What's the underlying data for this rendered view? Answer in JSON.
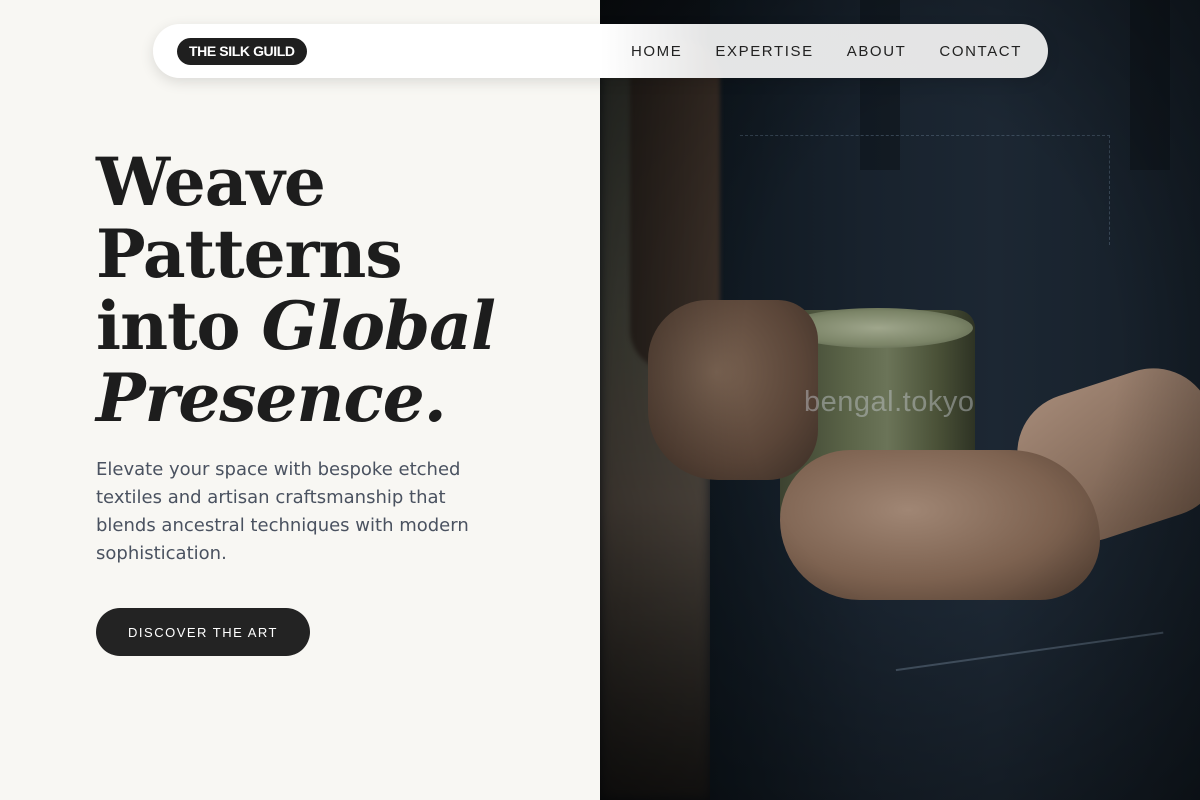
{
  "brand": {
    "name": "THE SILK GUILD"
  },
  "nav": {
    "items": [
      {
        "label": "HOME"
      },
      {
        "label": "EXPERTISE"
      },
      {
        "label": "ABOUT"
      },
      {
        "label": "CONTACT"
      }
    ]
  },
  "hero": {
    "headline_line1": "Weave",
    "headline_line2": "Patterns",
    "headline_line3_plain": "into ",
    "headline_line3_italic": "Global",
    "headline_line4_italic": "Presence.",
    "subtext": "Elevate your space with bespoke etched textiles and artisan craftsmanship that blends ancestral techniques with modern sophistication.",
    "cta_label": "DISCOVER THE ART"
  },
  "image": {
    "description_icon": "photo-person-holding-mug",
    "watermark": "bengal.tokyo"
  },
  "colors": {
    "background": "#f8f7f3",
    "text_dark": "#1d1d1d",
    "text_muted": "#4a5260",
    "button": "#232323"
  }
}
